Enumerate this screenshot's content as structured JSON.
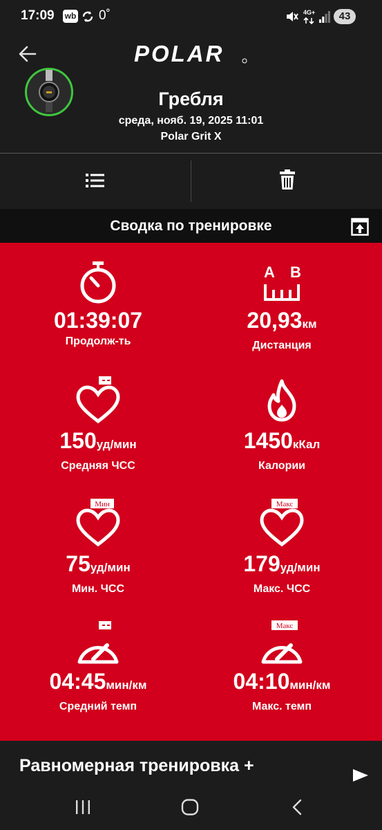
{
  "status_bar": {
    "time": "17:09",
    "wb": "wb",
    "temperature": "0˚",
    "network": "4G+",
    "battery": "43"
  },
  "header": {
    "brand": "POLAR",
    "title": "Гребля",
    "date": "среда, нояб. 19, 2025 11:01",
    "device": "Polar Grit X"
  },
  "summary": {
    "title": "Сводка по тренировке"
  },
  "stats": [
    {
      "value": "01:39:07",
      "unit": "",
      "label": "Продолж-ть",
      "icon": "stopwatch-icon"
    },
    {
      "value": "20,93",
      "unit": "км",
      "label": "Дистанция",
      "icon": "distance-icon",
      "icon_text_a": "A",
      "icon_text_b": "B"
    },
    {
      "value": "150",
      "unit": "уд/мин",
      "label": "Средняя ЧСС",
      "icon": "heart-icon"
    },
    {
      "value": "1450",
      "unit": "кКал",
      "label": "Калории",
      "icon": "flame-icon"
    },
    {
      "value": "75",
      "unit": "уд/мин",
      "label": "Мин. ЧСС",
      "icon": "heart-icon",
      "badge": "Мин"
    },
    {
      "value": "179",
      "unit": "уд/мин",
      "label": "Макс. ЧСС",
      "icon": "heart-icon",
      "badge": "Макс"
    },
    {
      "value": "04:45",
      "unit": "мин/км",
      "label": "Средний темп",
      "icon": "speedometer-icon"
    },
    {
      "value": "04:10",
      "unit": "мин/км",
      "label": "Макс. темп",
      "icon": "speedometer-icon",
      "badge": "Макс"
    }
  ],
  "bottom": {
    "title": "Равномерная тренировка +"
  },
  "colors": {
    "accent_red": "#d2001c",
    "background": "#1c1c1c",
    "avatar_ring": "#3ec63e"
  }
}
